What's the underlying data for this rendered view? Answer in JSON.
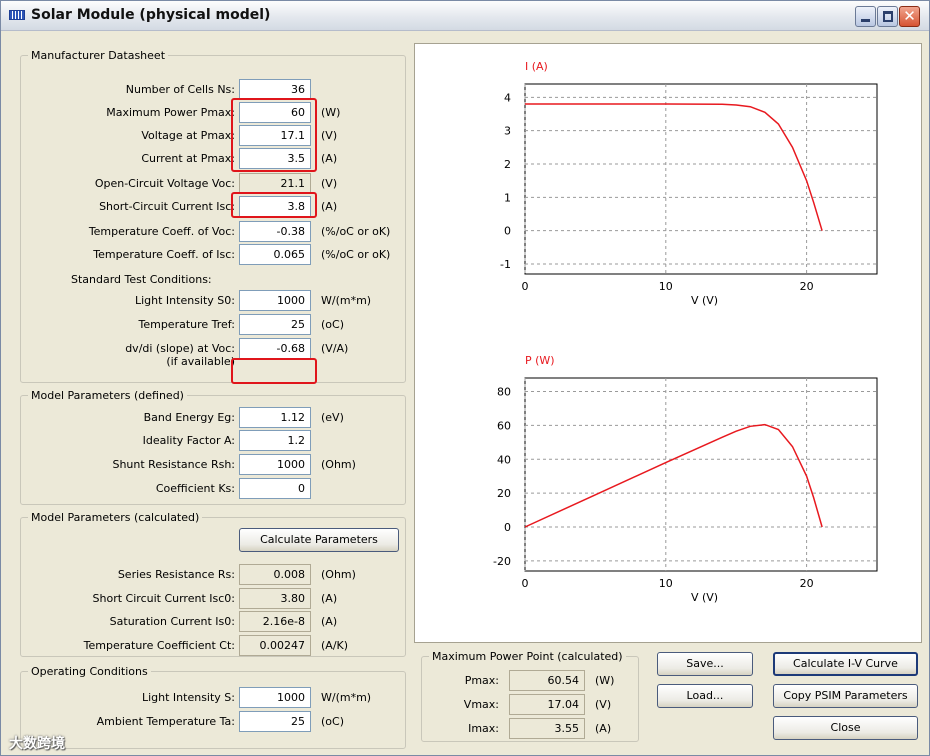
{
  "window": {
    "title": "Solar Module (physical model)"
  },
  "manufacturer": {
    "legend": "Manufacturer Datasheet",
    "rows": [
      {
        "label": "Number of Cells Ns:",
        "value": "36",
        "unit": ""
      },
      {
        "label": "Maximum Power Pmax:",
        "value": "60",
        "unit": "(W)"
      },
      {
        "label": "Voltage at Pmax:",
        "value": "17.1",
        "unit": "(V)"
      },
      {
        "label": "Current at Pmax:",
        "value": "3.5",
        "unit": "(A)"
      },
      {
        "label": "Open-Circuit Voltage Voc:",
        "value": "21.1",
        "unit": "(V)"
      },
      {
        "label": "Short-Circuit Current Isc:",
        "value": "3.8",
        "unit": "(A)"
      },
      {
        "label": "Temperature Coeff. of Voc:",
        "value": "-0.38",
        "unit": "(%/oC or oK)"
      },
      {
        "label": "Temperature Coeff. of Isc:",
        "value": "0.065",
        "unit": "(%/oC or oK)"
      }
    ],
    "stc_label": "Standard Test Conditions:",
    "stc_rows": [
      {
        "label": "Light Intensity S0:",
        "value": "1000",
        "unit": "W/(m*m)"
      },
      {
        "label": "Temperature Tref:",
        "value": "25",
        "unit": "(oC)"
      },
      {
        "label": "dv/di (slope) at Voc:",
        "value": "-0.68",
        "unit": "(V/A)"
      }
    ],
    "if_available": "(if available)"
  },
  "model_defined": {
    "legend": "Model Parameters (defined)",
    "rows": [
      {
        "label": "Band Energy Eg:",
        "value": "1.12",
        "unit": "(eV)"
      },
      {
        "label": "Ideality Factor A:",
        "value": "1.2",
        "unit": ""
      },
      {
        "label": "Shunt Resistance Rsh:",
        "value": "1000",
        "unit": "(Ohm)"
      },
      {
        "label": "Coefficient Ks:",
        "value": "0",
        "unit": ""
      }
    ]
  },
  "model_calculated": {
    "legend": "Model Parameters (calculated)",
    "calc_button": "Calculate Parameters",
    "rows": [
      {
        "label": "Series Resistance Rs:",
        "value": "0.008",
        "unit": "(Ohm)"
      },
      {
        "label": "Short Circuit Current Isc0:",
        "value": "3.80",
        "unit": "(A)"
      },
      {
        "label": "Saturation Current Is0:",
        "value": "2.16e-8",
        "unit": "(A)"
      },
      {
        "label": "Temperature Coefficient Ct:",
        "value": "0.00247",
        "unit": "(A/K)"
      }
    ]
  },
  "operating": {
    "legend": "Operating Conditions",
    "rows": [
      {
        "label": "Light Intensity S:",
        "value": "1000",
        "unit": "W/(m*m)"
      },
      {
        "label": "Ambient Temperature Ta:",
        "value": "25",
        "unit": "(oC)"
      }
    ]
  },
  "mpp": {
    "legend": "Maximum Power Point (calculated)",
    "rows": [
      {
        "label": "Pmax:",
        "value": "60.54",
        "unit": "(W)"
      },
      {
        "label": "Vmax:",
        "value": "17.04",
        "unit": "(V)"
      },
      {
        "label": "Imax:",
        "value": "3.55",
        "unit": "(A)"
      }
    ]
  },
  "buttons": {
    "save": "Save...",
    "load": "Load...",
    "calc_iv": "Calculate I-V Curve",
    "copy_psim": "Copy PSIM Parameters",
    "close": "Close"
  },
  "watermark": "大数跨境",
  "colors": {
    "curve": "#e8191f",
    "highlight": "#e0151b"
  },
  "chart_data": [
    {
      "type": "line",
      "title": "I (A)",
      "xlabel": "V (V)",
      "ylabel": "I (A)",
      "xlim": [
        0,
        25
      ],
      "ylim": [
        -1.3,
        4.4
      ],
      "xticks": [
        0,
        10,
        20
      ],
      "yticks": [
        4,
        3,
        2,
        1,
        0,
        -1
      ],
      "grid": true,
      "series": [
        {
          "x": [
            0,
            5,
            10,
            14,
            15,
            16,
            17.04,
            18,
            19,
            20,
            20.5,
            21.1
          ],
          "y": [
            3.8,
            3.8,
            3.8,
            3.79,
            3.77,
            3.72,
            3.55,
            3.2,
            2.5,
            1.5,
            0.85,
            0
          ]
        }
      ]
    },
    {
      "type": "line",
      "title": "P (W)",
      "xlabel": "V (V)",
      "ylabel": "P (W)",
      "xlim": [
        0,
        25
      ],
      "ylim": [
        -26,
        88
      ],
      "xticks": [
        0,
        10,
        20
      ],
      "yticks": [
        80,
        60,
        40,
        20,
        0,
        -20
      ],
      "grid": true,
      "series": [
        {
          "x": [
            0,
            5,
            10,
            14,
            15,
            16,
            17.04,
            18,
            19,
            20,
            20.5,
            21.1
          ],
          "y": [
            0,
            19,
            38,
            53,
            56.6,
            59.5,
            60.5,
            57.6,
            47.5,
            30,
            17.4,
            0
          ]
        }
      ]
    }
  ]
}
